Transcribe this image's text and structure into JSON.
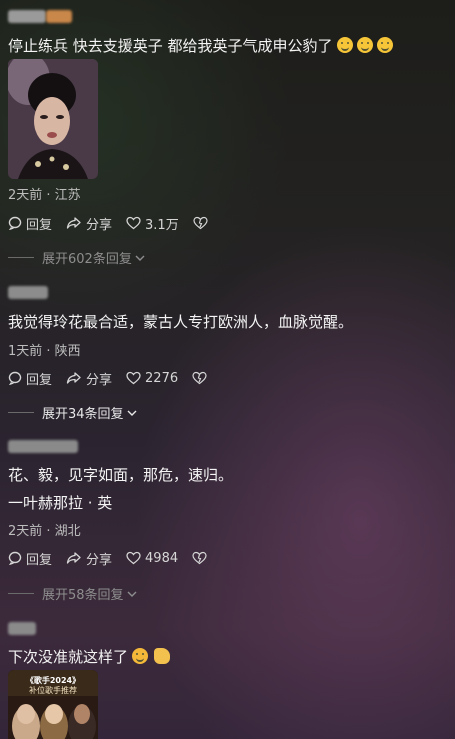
{
  "comments": [
    {
      "text": "停止练兵 快去支援英子 都给我英子气成申公豹了",
      "meta": "2天前 · 江苏",
      "reply_label": "回复",
      "share_label": "分享",
      "likes": "3.1万",
      "expand_label": "展开602条回复"
    },
    {
      "text": "我觉得玲花最合适，蒙古人专打欧洲人，血脉觉醒。",
      "meta": "1天前 · 陕西",
      "reply_label": "回复",
      "share_label": "分享",
      "likes": "2276",
      "expand_label": "展开34条回复"
    },
    {
      "text_line1": "花、毅，见字如面，那危，速归。",
      "text_line2": "一叶赫那拉 · 英",
      "meta": "2天前 · 湖北",
      "reply_label": "回复",
      "share_label": "分享",
      "likes": "4984",
      "expand_label": "展开58条回复"
    },
    {
      "text": "下次没准就这样了",
      "thumb_title": "《歌手2024》",
      "thumb_subtitle": "补位歌手推荐"
    }
  ],
  "colors": {
    "accent_orange": "#c9874a",
    "muted_text": "#8e8e8e"
  },
  "icons": [
    "reply-icon",
    "share-icon",
    "like-icon",
    "dislike-icon",
    "chevron-down-icon"
  ]
}
